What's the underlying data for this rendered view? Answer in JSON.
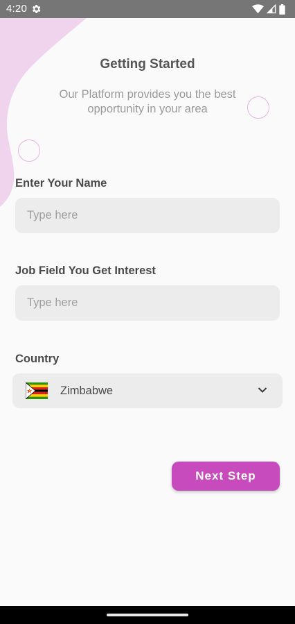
{
  "status_bar": {
    "time": "4:20",
    "icons": [
      "settings-icon",
      "wifi-icon",
      "signal-icon",
      "battery-icon"
    ]
  },
  "header": {
    "title": "Getting Started",
    "subtitle": "Our Platform provides you the best opportunity in your area"
  },
  "form": {
    "name": {
      "label": "Enter Your Name",
      "placeholder": "Type here",
      "value": ""
    },
    "job_field": {
      "label": "Job Field You Get Interest",
      "placeholder": "Type here",
      "value": ""
    },
    "country": {
      "label": "Country",
      "selected": "Zimbabwe",
      "flag_icon": "zimbabwe-flag-icon"
    }
  },
  "actions": {
    "next_label": "Next Step"
  },
  "colors": {
    "accent": "#c84bbd",
    "decoration": "#f0d3ec",
    "input_bg": "#ececec",
    "status_bar": "#767676"
  }
}
